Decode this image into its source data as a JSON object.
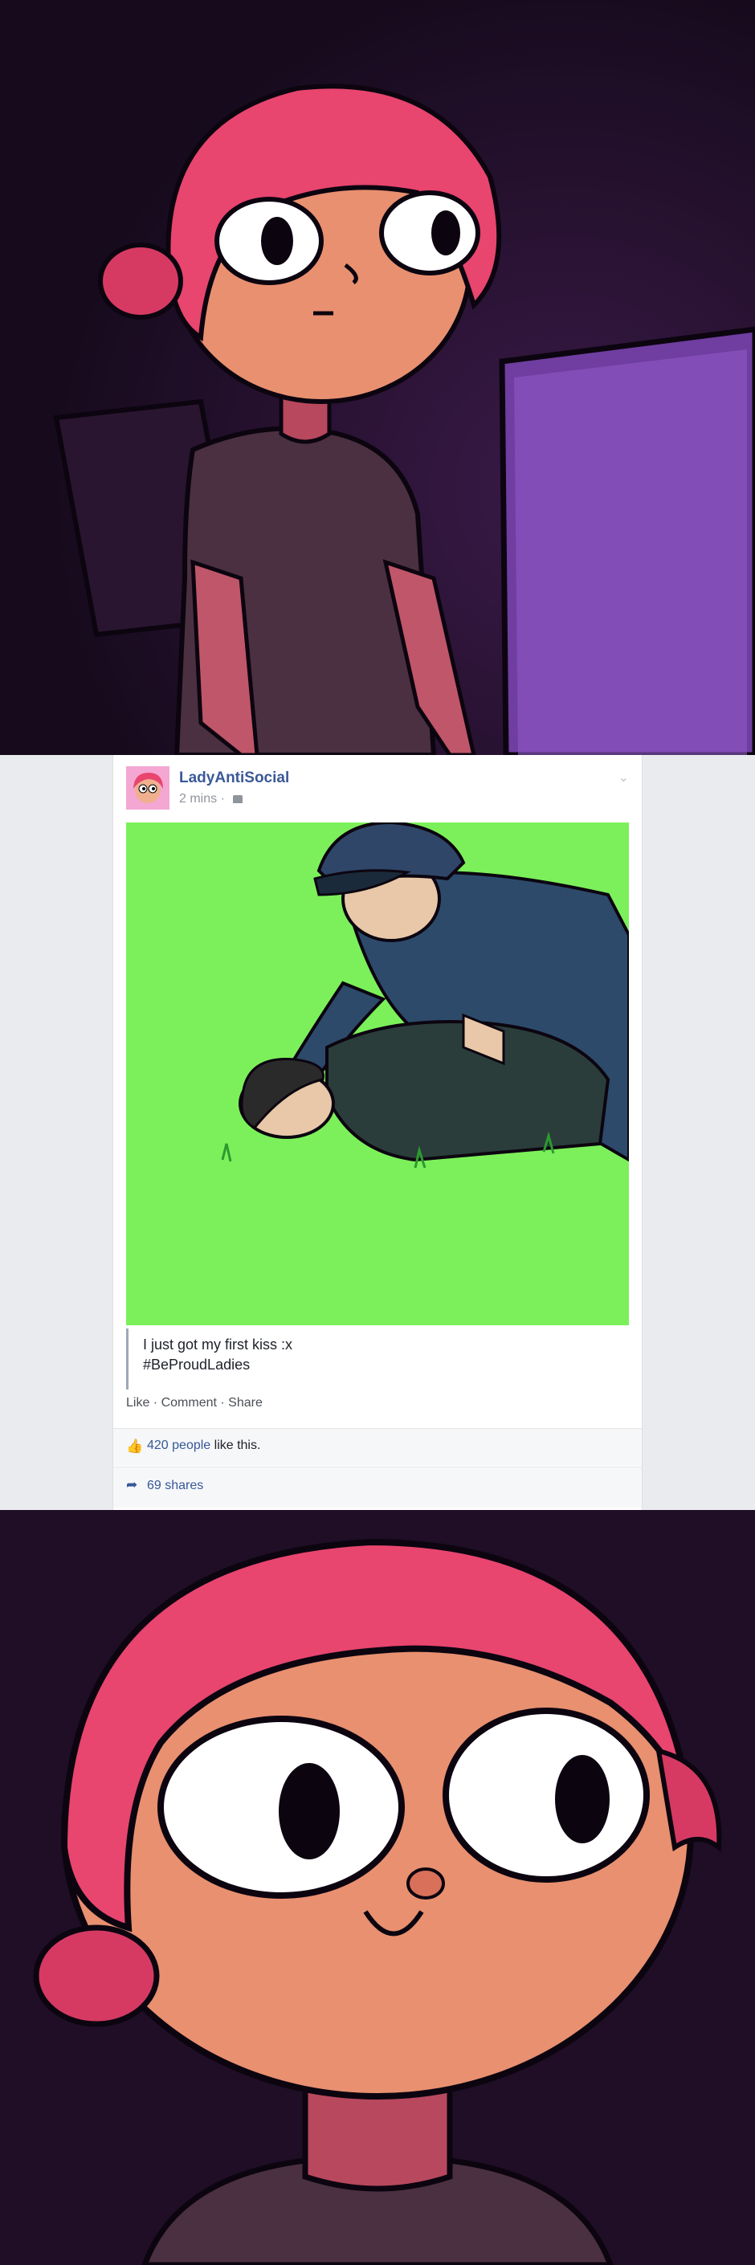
{
  "post": {
    "author": "LadyAntiSocial",
    "time": "2 mins",
    "dot": "·",
    "caption_line1": "I just got my first kiss :x",
    "caption_line2": "#BeProudLadies",
    "actions": {
      "like": "Like",
      "comment": "Comment",
      "share": "Share",
      "sep": " · "
    },
    "likes": {
      "count_text": "420 people",
      "suffix": " like this."
    },
    "shares": {
      "text": "69 shares"
    }
  },
  "colors": {
    "hair": "#e8456f",
    "skin": "#f0a07a",
    "background_dark": "#1f0e26",
    "screen_glow": "#7a45a8",
    "feed_bg": "#e9ebee",
    "link_blue": "#3b5998",
    "image_green": "#7cf05a"
  },
  "icons": {
    "chevron": "chevron-down-icon",
    "friends": "friends-icon",
    "like": "thumbs-up-icon",
    "share": "share-arrow-icon"
  }
}
